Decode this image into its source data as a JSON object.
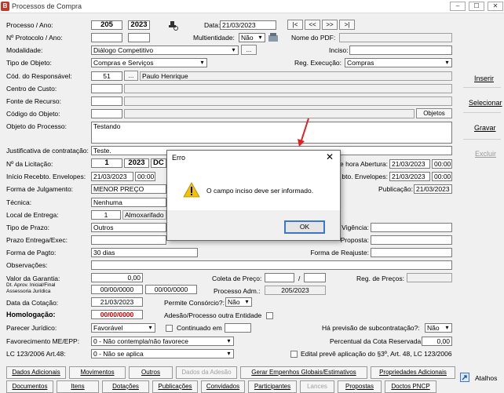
{
  "window": {
    "title": "Processos de Compra",
    "app_icon": "B",
    "minimize": "–",
    "maximize": "☐",
    "close": "✕"
  },
  "form": {
    "processo_label": "Processo / Ano:",
    "processo": "205",
    "ano": "2023",
    "data_label": "Data:",
    "data": "21/03/2023",
    "nav": [
      "|<",
      "<<",
      ">>",
      ">|"
    ],
    "protocolo_label": "Nº Protocolo / Ano:",
    "multientidade_label": "Multientidade:",
    "multientidade": "Não",
    "nome_pdf_label": "Nome do PDF:",
    "modalidade_label": "Modalidade:",
    "modalidade": "Diálogo Competitivo",
    "modalidade_btn": "...",
    "inciso_label": "Inciso:",
    "tipo_objeto_label": "Tipo de Objeto:",
    "tipo_objeto": "Compras e Serviços",
    "reg_execucao_label": "Reg. Execução:",
    "reg_execucao": "Compras",
    "responsavel_label": "Cód. do Responsável:",
    "responsavel_cod": "51",
    "responsavel_btn": "...",
    "responsavel_nome": "Paulo Henrique",
    "centro_custo_label": "Centro de Custo:",
    "fonte_recurso_label": "Fonte de Recurso:",
    "codigo_objeto_label": "Código do Objeto:",
    "objetos_btn": "Objetos",
    "objeto_processo_label": "Objeto do Processo:",
    "objeto_processo": "Testando",
    "justificativa_label": "Justificativa de contratação:",
    "justificativa": "Teste.",
    "licitacao_label": "Nº da Licitação:",
    "licitacao": "1",
    "licitacao_ano": "2023",
    "licitacao_tipo": "DC",
    "hora_abertura_label": "e hora Abertura:",
    "hora_abertura_data": "21/03/2023",
    "hora_abertura_hora": "00:00",
    "inicio_receb_label": "Início Recebto. Envelopes:",
    "inicio_receb_data": "21/03/2023",
    "inicio_receb_hora": "00:00",
    "fim_receb_label": "bto. Envelopes:",
    "fim_receb_data": "21/03/2023",
    "fim_receb_hora": "00:00",
    "forma_julgamento_label": "Forma de Julgamento:",
    "forma_julgamento": "MENOR PREÇO",
    "publicacao_label": "Publicação:",
    "publicacao": "21/03/2023",
    "tecnica_label": "Técnica:",
    "tecnica": "Nenhuma",
    "local_entrega_label": "Local de Entrega:",
    "local_entrega_cod": "1",
    "local_entrega_nome": "Almoxarifado (",
    "tipo_prazo_label": "Tipo de Prazo:",
    "tipo_prazo": "Outros",
    "vigencia_label": "Vigência:",
    "prazo_entrega_label": "Prazo Entrega/Exec:",
    "proposta_label": "Proposta:",
    "forma_pagto_label": "Forma de Pagto:",
    "forma_pagto": "30 dias",
    "forma_reajuste_label": "Forma de Reajuste:",
    "observacoes_label": "Observações:",
    "valor_garantia_label": "Valor da Garantia:",
    "valor_garantia": "0,00",
    "coleta_preco_label": "Coleta de Preço:",
    "coleta_sep": "/",
    "reg_precos_label": "Reg. de Preços:",
    "aprov_label": "Dt. Aprov. Inicial/Final",
    "assessoria_label": "Assessoria Jurídica",
    "aprov_inicial": "00/00/0000",
    "aprov_final": "00/00/0000",
    "processo_adm_label": "Processo Adm.:",
    "processo_adm": "205/2023",
    "data_cotacao_label": "Data da Cotação:",
    "data_cotacao": "21/03/2023",
    "consorcio_label": "Permite Consórcio?:",
    "consorcio": "Não",
    "homologacao_label": "Homologação:",
    "homologacao": "00/00/0000",
    "adesao_label": "Adesão/Processo outra Entidade",
    "parecer_label": "Parecer Jurídico:",
    "parecer": "Favorável",
    "continuado_label": "Continuado em",
    "subcontratacao_label": "Há previsão de subcontratação?:",
    "subcontratacao": "Não",
    "favorecimento_label": "Favorecimento ME/EPP:",
    "favorecimento": "0 - Não contempla/não favorece",
    "percentual_cota_label": "Percentual da Cota Reservada:",
    "percentual_cota": "0,00",
    "lc_label": "LC 123/2006 Art.48:",
    "lc": "0 - Não se aplica",
    "edital_label": "Edital prevê aplicação do §3º, Art. 48, LC 123/2006"
  },
  "side_buttons": {
    "inserir": "Inserir",
    "selecionar": "Selecionar",
    "gravar": "Gravar",
    "excluir": "Excluir"
  },
  "toolbar_row1": [
    "Dados Adicionais",
    "Movimentos",
    "Outros",
    "Dados da Adesão",
    "Gerar Empenhos Globais/Estimativos",
    "Propriedades Adicionais"
  ],
  "toolbar_row2": [
    "Documentos",
    "Itens",
    "Dotações",
    "Publicações",
    "Convidados",
    "Participantes",
    "Lances",
    "Propostas",
    "Doctos PNCP"
  ],
  "atalhos": "Atalhos",
  "dialog": {
    "title": "Erro",
    "close": "✕",
    "message": "O campo inciso deve ser informado.",
    "ok": "OK"
  },
  "colors": {
    "accent": "#3c78c8",
    "error_arrow": "#e02020",
    "warning_icon": "#f2c200"
  }
}
